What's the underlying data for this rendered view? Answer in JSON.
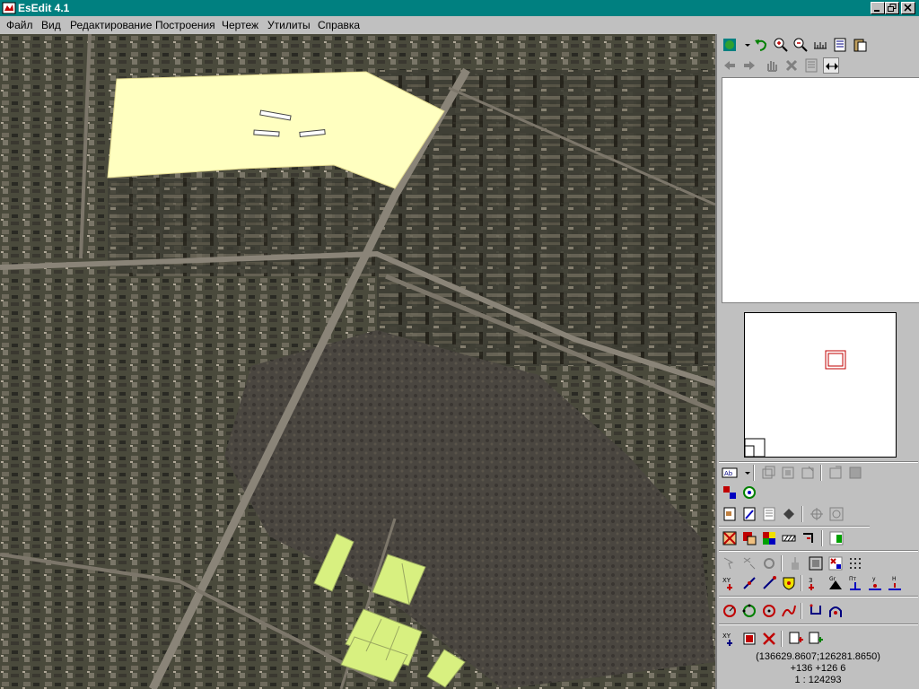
{
  "window": {
    "title": "EsEdit 4.1"
  },
  "menu": [
    {
      "label": "Файл"
    },
    {
      "label": "Вид"
    },
    {
      "label": "Редактирование"
    },
    {
      "label": "Построения"
    },
    {
      "label": "Чертеж"
    },
    {
      "label": "Утилиты"
    },
    {
      "label": "Справка"
    }
  ],
  "status": {
    "coordinates": "(136629.8607;126281.8650)",
    "offset": "+136  +126  6",
    "scale": "1 : 124293"
  },
  "colors": {
    "titlebar": "#008080",
    "polygon_large": "#ffffc0",
    "polygon_green": "#d8f080",
    "overview_rect": "#c00000"
  }
}
